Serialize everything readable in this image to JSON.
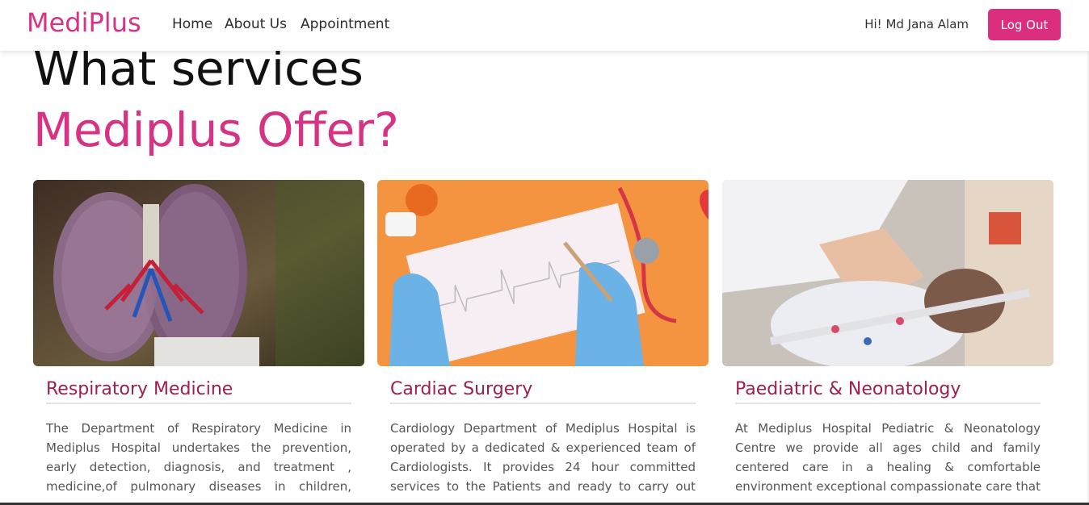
{
  "nav": {
    "brand": "MediPlus",
    "links": [
      "Home",
      "About Us",
      "Appointment"
    ],
    "greeting": "Hi! Md Jana Alam",
    "logout_label": "Log Out"
  },
  "hero": {
    "line1": "What services",
    "line2": "Mediplus Offer?"
  },
  "services": [
    {
      "title": "Respiratory Medicine",
      "text": "The Department of Respiratory Medicine in Mediplus Hospital undertakes the prevention, early detection, diagnosis, and treatment , medicine,of pulmonary diseases in children, adolescents, and adults."
    },
    {
      "title": "Cardiac Surgery",
      "text": "Cardiology Department of Mediplus Hospital is operated by a dedicated & experienced team of Cardiologists. It provides 24 hour committed services to the Patients and ready to carry out any emergencies."
    },
    {
      "title": "Paediatric & Neonatology",
      "text": "At Mediplus Hospital Pediatric & Neonatology Centre we provide all ages child and family centered care in a healing & comfortable environment exceptional compassionate care that has been a hallmark."
    }
  ],
  "colors": {
    "accent": "#d63384",
    "button": "#dc2e7f",
    "card_title": "#9c1f52"
  }
}
